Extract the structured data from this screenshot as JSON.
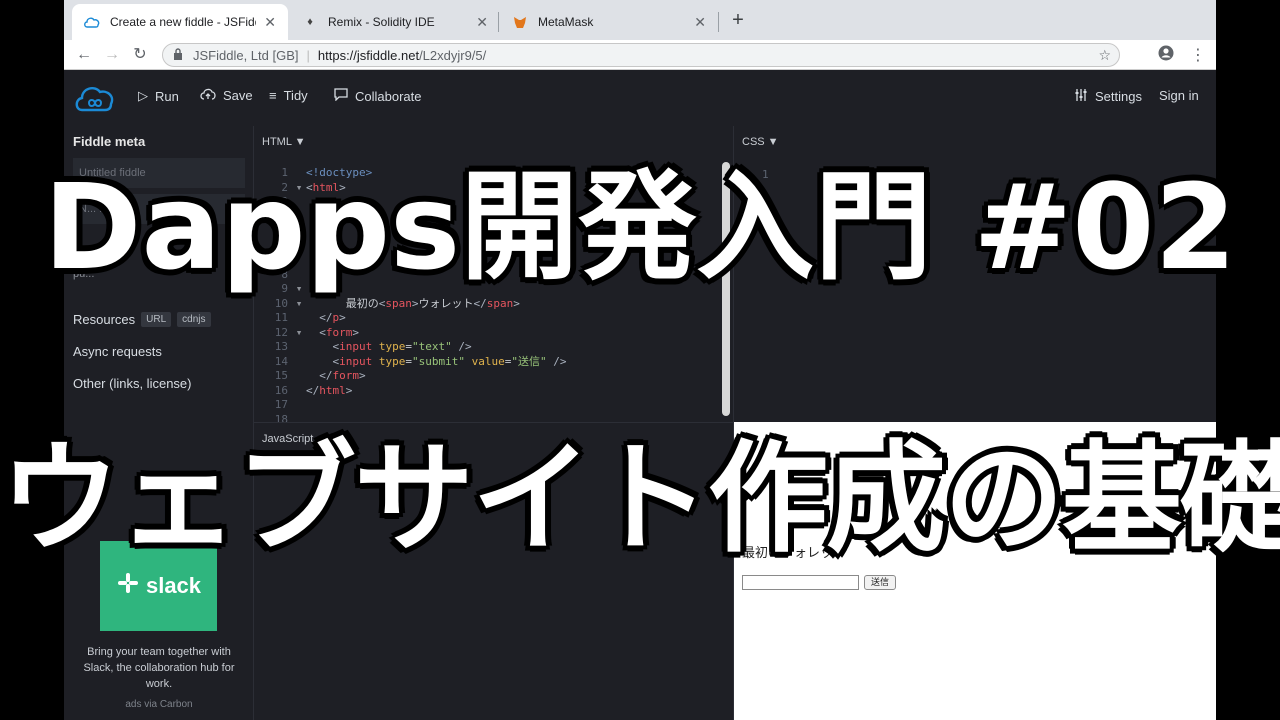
{
  "browser": {
    "tabs": [
      {
        "title": "Create a new fiddle - JSFiddle",
        "icon": "jsfiddle-icon",
        "active": true
      },
      {
        "title": "Remix - Solidity IDE",
        "icon": "remix-icon",
        "active": false
      },
      {
        "title": "MetaMask",
        "icon": "metamask-fox-icon",
        "active": false
      }
    ],
    "new_tab": "+",
    "omnibox": {
      "org": "JSFiddle, Ltd [GB]",
      "url_host": "https://jsfiddle.net",
      "url_path": "/L2xdyjr9/5/"
    }
  },
  "jsfiddle": {
    "actions": {
      "run": "Run",
      "save": "Save",
      "tidy": "Tidy",
      "collaborate": "Collaborate",
      "settings": "Settings",
      "signin": "Sign in"
    },
    "sidebar": {
      "title": "Fiddle meta",
      "name_placeholder": "Untitled fiddle",
      "desc_placeholder": "N... ...ription",
      "note": "Ad...",
      "note2": "pu...",
      "resources": "Resources",
      "res_badge_url": "URL",
      "res_badge_cdnjs": "cdnjs",
      "async": "Async requests",
      "other": "Other (links, license)",
      "ad_brand": "slack",
      "ad_text": "Bring your team together with Slack, the collaboration hub for work.",
      "ad_via": "ads via Carbon"
    },
    "panels": {
      "html_label": "HTML ▼",
      "css_label": "CSS ▼",
      "js_label": "JavaScript",
      "css_line": "1"
    },
    "result": {
      "text": "最初のウォレット",
      "submit": "送信"
    }
  },
  "overlay": {
    "line1": "Dapps開発入門 #02",
    "line2": "ウェブサイト作成の基礎"
  },
  "colors": {
    "jsfiddle_bg": "#1e1f25",
    "tag": "#e5555f",
    "attr": "#e0b34d",
    "string": "#98c379",
    "slack_green": "#2fb57e"
  }
}
